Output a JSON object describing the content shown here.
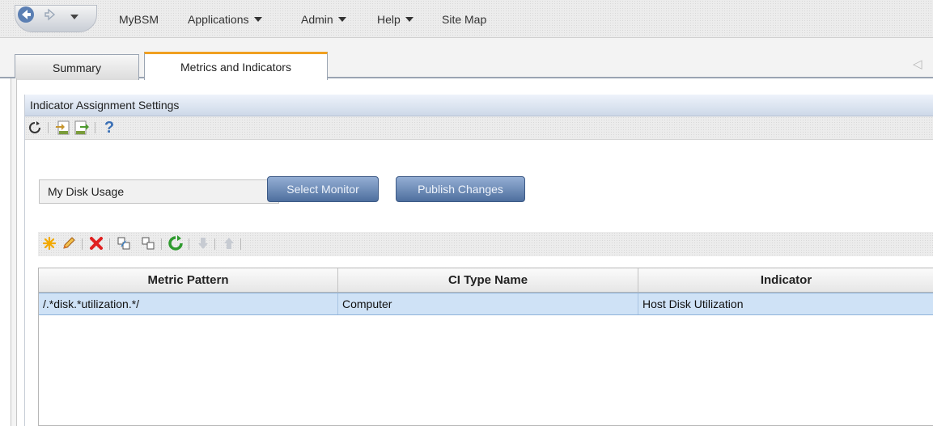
{
  "nav": {
    "back_icon": "back-arrow-icon",
    "forward_icon": "forward-arrow-icon",
    "menu_items": [
      {
        "label": "MyBSM",
        "has_caret": false
      },
      {
        "label": "Applications",
        "has_caret": true
      },
      {
        "label": "Admin",
        "has_caret": true
      },
      {
        "label": "Help",
        "has_caret": true
      },
      {
        "label": "Site Map",
        "has_caret": false
      }
    ]
  },
  "tabs": [
    {
      "label": "Summary",
      "active": false
    },
    {
      "label": "Metrics and Indicators",
      "active": true
    }
  ],
  "panel": {
    "title": "Indicator Assignment Settings",
    "toolbar_icons": [
      "refresh-icon",
      "import-xml-icon",
      "export-xml-icon",
      "help-icon"
    ],
    "help_glyph": "?"
  },
  "monitor": {
    "value": "My Disk Usage",
    "select_label": "Select Monitor",
    "publish_label": "Publish Changes"
  },
  "grid_toolbar": [
    "new-icon",
    "edit-icon",
    "delete-icon",
    "copy-icon",
    "paste-icon",
    "refresh-green-icon",
    "move-down-icon",
    "move-up-icon"
  ],
  "grid": {
    "columns": [
      "Metric Pattern",
      "CI Type Name",
      "Indicator"
    ],
    "rows": [
      [
        "/.*disk.*utilization.*/",
        "Computer",
        "Host Disk Utilization"
      ]
    ]
  },
  "colors": {
    "active_tab_accent": "#f0a020",
    "button_blue": "#4e6f9e",
    "row_selected": "#cfe2f6"
  }
}
